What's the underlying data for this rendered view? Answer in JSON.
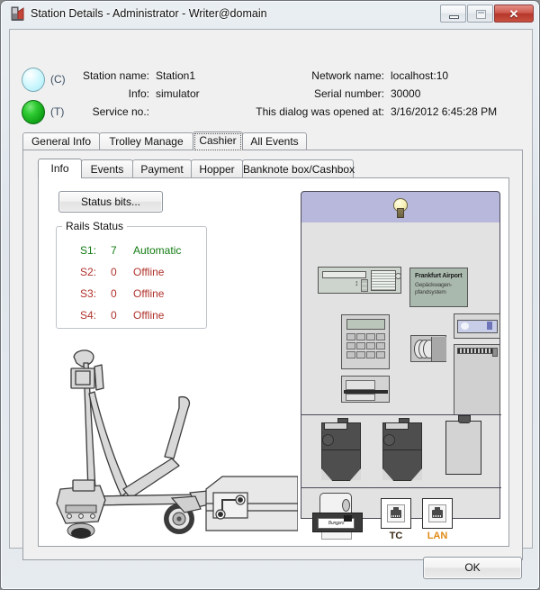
{
  "window": {
    "title": "Station Details - Administrator - Writer@domain",
    "icon": "app-icon",
    "controls": {
      "minimize": "minimize-icon",
      "maximize": "maximize-icon",
      "close": "✕"
    }
  },
  "header": {
    "indicators": [
      {
        "key": "c",
        "label": "(C)",
        "color": "#bff3fb",
        "name": "status-led-c"
      },
      {
        "key": "t",
        "label": "(T)",
        "color": "#11a317",
        "name": "status-led-t"
      }
    ],
    "left_fields": [
      {
        "label": "Station name:",
        "value": "Station1"
      },
      {
        "label": "Info:",
        "value": "simulator"
      },
      {
        "label": "Service no.:",
        "value": ""
      }
    ],
    "right_fields": [
      {
        "label": "Network name:",
        "value": "localhost:10"
      },
      {
        "label": "Serial number:",
        "value": "30000"
      },
      {
        "label": "This dialog was opened at:",
        "value": "3/16/2012 6:45:28 PM"
      }
    ]
  },
  "outer_tabs": {
    "selected": "Cashier",
    "items": [
      {
        "label": "General Info"
      },
      {
        "label": "Trolley Manage"
      },
      {
        "label": "Cashier"
      },
      {
        "label": "All Events"
      }
    ]
  },
  "inner_tabs": {
    "selected": "Info",
    "items": [
      {
        "label": "Info"
      },
      {
        "label": "Events"
      },
      {
        "label": "Payment"
      },
      {
        "label": "Hopper"
      },
      {
        "label": "Banknote box/Cashbox"
      }
    ]
  },
  "content": {
    "status_bits_button": "Status bits...",
    "rails": {
      "title": "Rails Status",
      "ok_color": "#127a12",
      "bad_color": "#b0322b",
      "rows": [
        {
          "name": "S1:",
          "count": "7",
          "status": "Automatic",
          "state": "ok"
        },
        {
          "name": "S2:",
          "count": "0",
          "status": "Offline",
          "state": "bad"
        },
        {
          "name": "S3:",
          "count": "0",
          "status": "Offline",
          "state": "bad"
        },
        {
          "name": "S4:",
          "count": "0",
          "status": "Offline",
          "state": "bad"
        }
      ]
    },
    "machine": {
      "header_color": "#b8b8dc",
      "lamp": "lightbulb-icon",
      "sign": {
        "line1": "Frankfurt Airport",
        "line2": "Gepäckwagen-",
        "line3": "pfandsystem"
      },
      "printer_label": "Bungpro",
      "ports": [
        {
          "label": "TC",
          "color": "#3a2a14"
        },
        {
          "label": "LAN",
          "color": "#e08a14"
        }
      ]
    },
    "trolley_image": "luggage-trolley-illustration"
  },
  "footer": {
    "ok_button": "OK"
  }
}
